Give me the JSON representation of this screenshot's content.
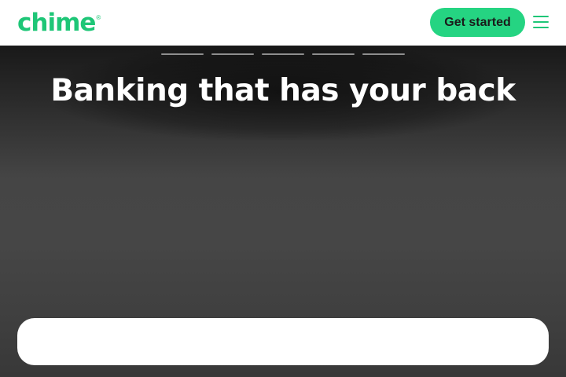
{
  "brand": {
    "logo_text": "chime",
    "logo_mark": "®",
    "accent_color": "#1ec677",
    "button_color": "#25d482"
  },
  "header": {
    "cta_label": "Get started",
    "menu_icon": "hamburger-menu-icon"
  },
  "hero": {
    "headline": "Banking that has your back",
    "slide_indicators": 5
  }
}
